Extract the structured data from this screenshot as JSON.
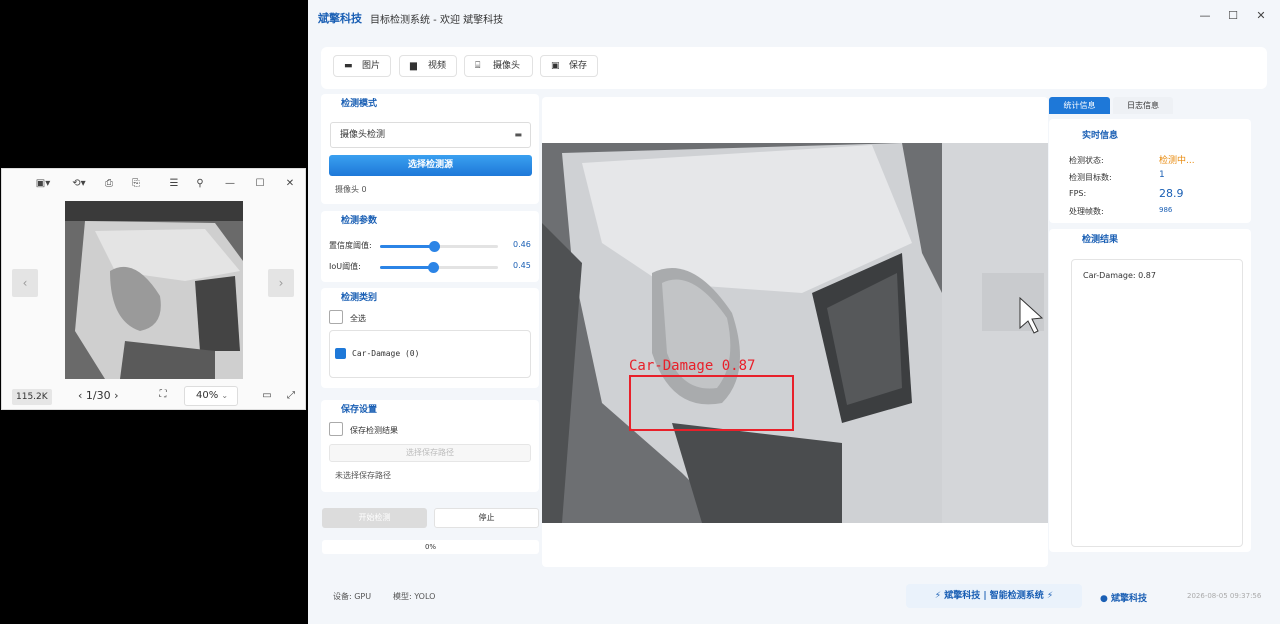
{
  "viewer": {
    "size_badge": "115.2K",
    "pager": "1/30",
    "zoom": "40%"
  },
  "app": {
    "brand": "斌擎科技",
    "subtitle": "目标检测系统 - 欢迎 斌擎科技",
    "toolbar": {
      "image_label": "图片",
      "video_label": "视频",
      "camera_label": "摄像头",
      "save_label": "保存"
    },
    "left": {
      "mode_title": "检测模式",
      "mode_value": "摄像头检测",
      "select_source_label": "选择检测源",
      "camera_label": "摄像头 0",
      "params_title": "检测参数",
      "confidence_label": "置信度阈值:",
      "confidence_value": "0.46",
      "confidence_fraction": 0.46,
      "iou_label": "IoU阈值:",
      "iou_value": "0.45",
      "iou_fraction": 0.45,
      "classes_title": "检测类别",
      "select_all_label": "全选",
      "class_item_label": "Car-Damage (0)",
      "save_title": "保存设置",
      "save_results_label": "保存检测结果",
      "select_path_label": "选择保存路径",
      "path_note": "未选择保存路径",
      "start_label": "开始检测",
      "stop_label": "停止",
      "progress_text": "0%"
    },
    "display": {
      "detection_label": "Car-Damage 0.87",
      "detection_color": "#e8202a"
    },
    "right": {
      "tab_stats": "统计信息",
      "tab_log": "日志信息",
      "realtime_title": "实时信息",
      "status_key": "检测状态:",
      "status_value": "检测中...",
      "status_color": "#e88a0c",
      "count_key": "检测目标数:",
      "count_value": "1",
      "fps_key": "FPS:",
      "fps_value": "28.9",
      "frames_key": "处理帧数:",
      "frames_value": "986",
      "results_title": "检测结果",
      "result_line": "Car-Damage: 0.87"
    },
    "statusbar": {
      "device": "设备: GPU",
      "model": "模型: YOLO",
      "banner": "⚡ 斌擎科技 | 智能检测系统 ⚡",
      "user": "斌擎科技",
      "time": "2026-08-05 09:37:56"
    },
    "colors": {
      "accent": "#1a5fb4",
      "primary_button": "#2b84e6"
    }
  }
}
